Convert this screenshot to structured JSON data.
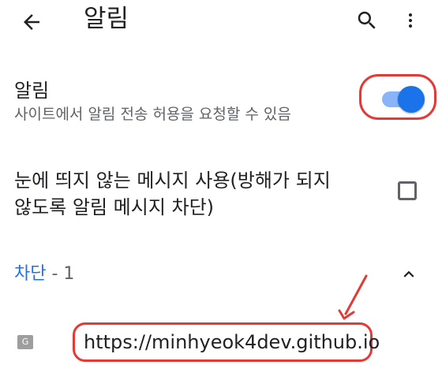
{
  "app_bar": {
    "title": "알림",
    "back_icon": "arrow-back-icon",
    "search_icon": "search-icon",
    "more_icon": "more-vert-icon"
  },
  "notifications": {
    "title": "알림",
    "subtitle": "사이트에서 알림 전송 허용을 요청할 수 있음",
    "toggle_on": true,
    "accent_color": "#1a73e8"
  },
  "quiet_messaging": {
    "label": "눈에 띄지 않는 메시지 사용(방해가 되지 않도록 알림 메시지 차단)",
    "checked": false
  },
  "blocked": {
    "label": "차단",
    "count": "- 1",
    "expanded": true,
    "sites": [
      {
        "favicon_letter": "G",
        "url": "https://minhyeok4dev.github.io"
      }
    ]
  },
  "annotation_color": "#e53935"
}
